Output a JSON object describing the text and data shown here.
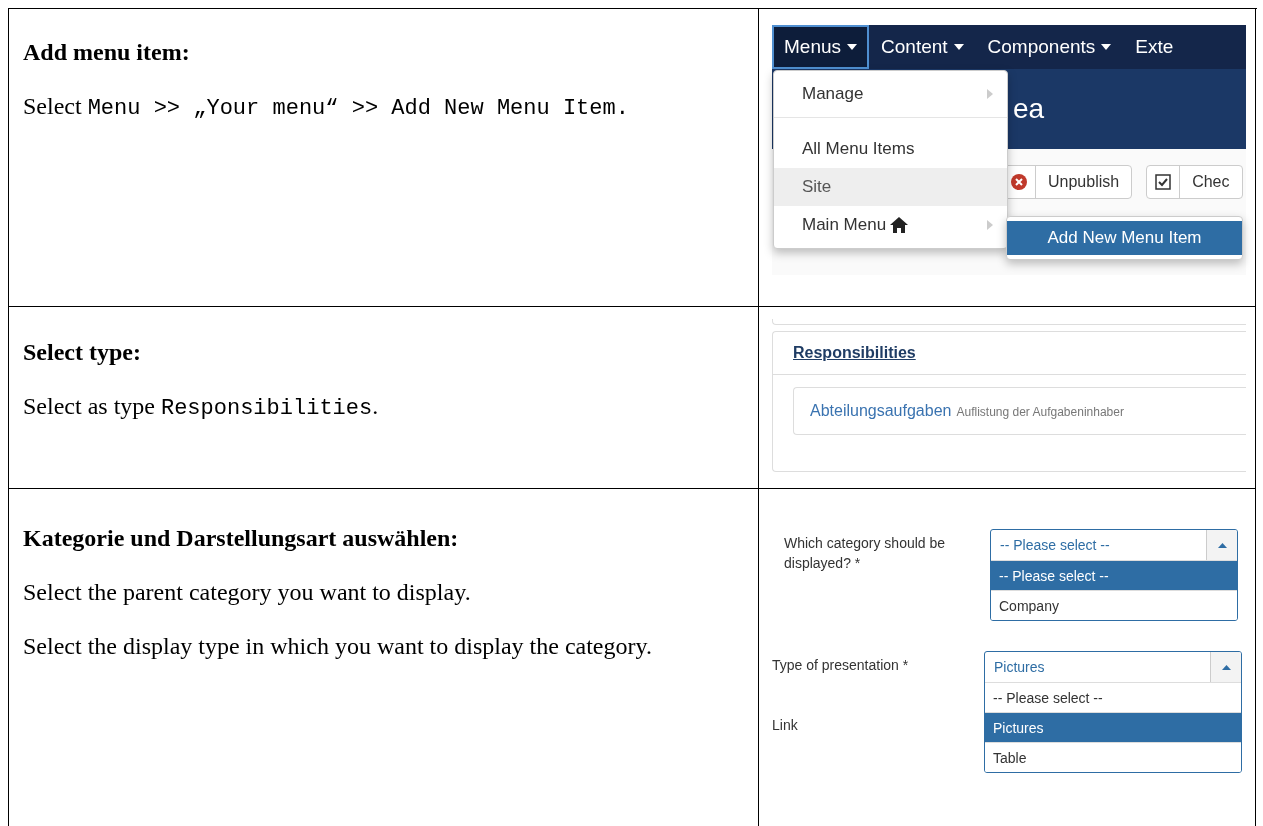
{
  "rows": [
    {
      "heading": "Add menu item:",
      "paragraphs": [
        [
          {
            "kind": "plain",
            "text": "Select "
          },
          {
            "kind": "code",
            "text": "Menu >> „Your menu“ >> Add New Menu Item."
          }
        ]
      ],
      "screenshot": {
        "kind": "menu",
        "nav": [
          {
            "label": "Menus",
            "caret": true,
            "selected": true
          },
          {
            "label": "Content",
            "caret": true,
            "selected": false
          },
          {
            "label": "Components",
            "caret": true,
            "selected": false
          },
          {
            "label": "Exte",
            "caret": false,
            "selected": false
          }
        ],
        "header_title": "ea",
        "toolbar": [
          {
            "kind": "icon-x",
            "label": "Unpublish"
          },
          {
            "kind": "check",
            "label": "Chec"
          }
        ],
        "menu": [
          {
            "label": "Manage",
            "submenu": true,
            "home": false,
            "hover": false,
            "divider_after": true
          },
          {
            "label": "All Menu Items",
            "submenu": false,
            "home": false,
            "hover": false,
            "divider_after": false
          },
          {
            "label": "Site",
            "submenu": false,
            "home": false,
            "hover": true,
            "divider_after": false
          },
          {
            "label": "Main Menu",
            "submenu": true,
            "home": true,
            "hover": false,
            "divider_after": false
          }
        ],
        "submenu": [
          {
            "label": "Add New Menu Item",
            "selected": true
          }
        ]
      }
    },
    {
      "heading": "Select type:",
      "paragraphs": [
        [
          {
            "kind": "plain",
            "text": "Select as type "
          },
          {
            "kind": "code",
            "text": "Responsibilities"
          },
          {
            "kind": "plain",
            "text": "."
          }
        ]
      ],
      "screenshot": {
        "kind": "types",
        "group": "Responsibilities",
        "items": [
          {
            "title": "Abteilungsaufgaben",
            "description": "Auflistung der Aufgabeninhaber"
          }
        ]
      }
    },
    {
      "heading": "Kategorie und Darstellungsart auswählen:",
      "paragraphs": [
        [
          {
            "kind": "plain",
            "text": "Select the parent category you want to display."
          }
        ],
        [
          {
            "kind": "plain",
            "text": "Select the display type in which you want to display the category."
          }
        ]
      ],
      "screenshot": {
        "kind": "form",
        "fields": [
          {
            "label": "Which category should be displayed? *",
            "value": "-- Please select --",
            "options": [
              {
                "label": "-- Please select --",
                "selected": true
              },
              {
                "label": "Company",
                "selected": false
              }
            ]
          },
          {
            "label": "Type of presentation *",
            "value": "Pictures",
            "options": [
              {
                "label": "-- Please select --",
                "selected": false
              },
              {
                "label": "Pictures",
                "selected": true
              },
              {
                "label": "Table",
                "selected": false
              }
            ]
          }
        ],
        "extra_label": "Link"
      }
    }
  ]
}
